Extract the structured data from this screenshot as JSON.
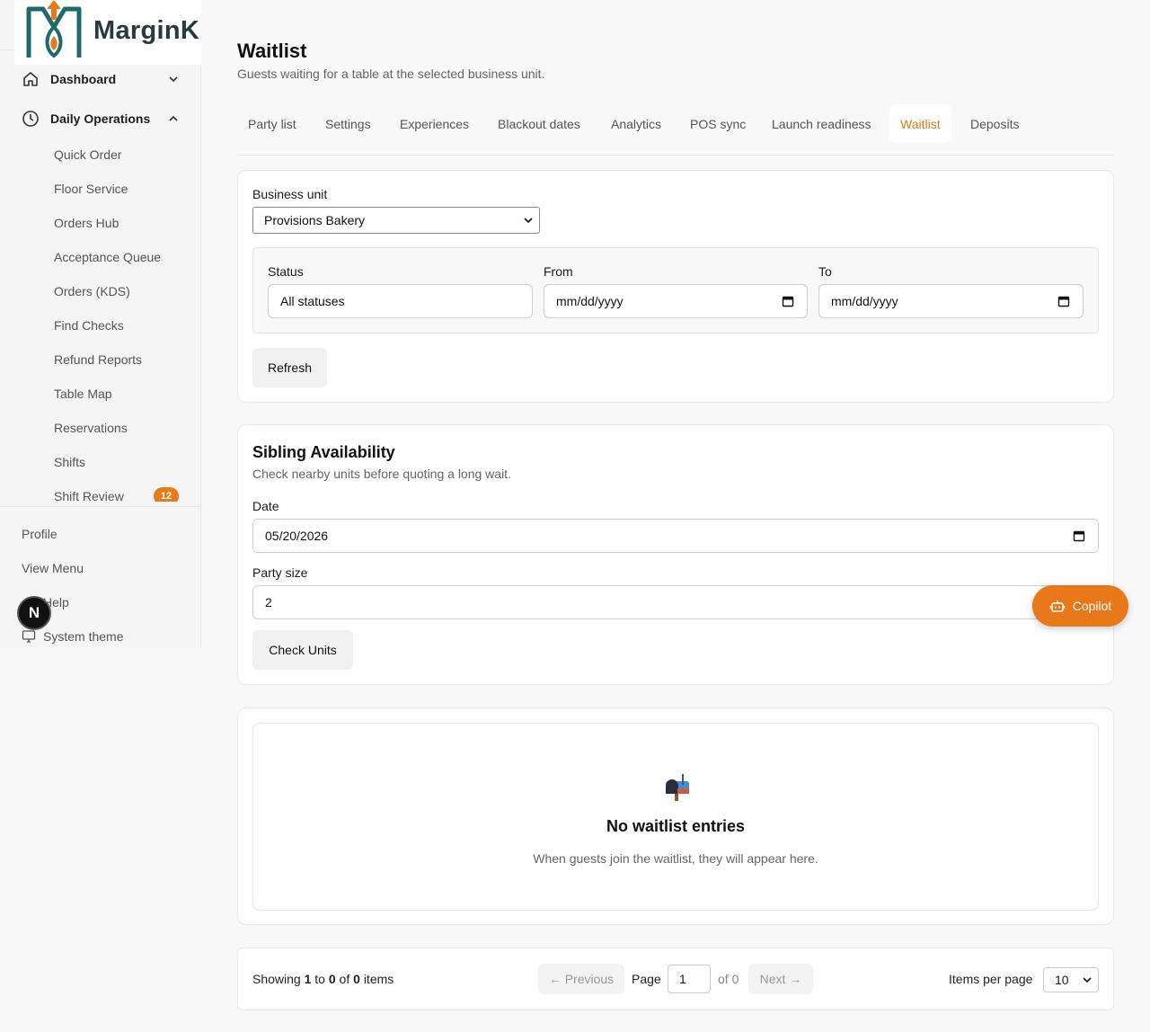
{
  "brand": {
    "name": "MarginK"
  },
  "sidebar": {
    "groups": [
      {
        "label": "Dashboard",
        "icon": "home-icon",
        "expanded": false
      },
      {
        "label": "Daily Operations",
        "icon": "clock-icon",
        "expanded": true
      }
    ],
    "sub_items": [
      "Quick Order",
      "Floor Service",
      "Orders Hub",
      "Acceptance Queue",
      "Orders (KDS)",
      "Find Checks",
      "Refund Reports",
      "Table Map",
      "Reservations",
      "Shifts",
      "Shift Review"
    ],
    "shift_review_badge": "12",
    "footer": {
      "profile": "Profile",
      "view_menu": "View Menu",
      "help": "Help",
      "theme": "System theme"
    },
    "avatar_letter": "N"
  },
  "page": {
    "title": "Waitlist",
    "subtitle": "Guests waiting for a table at the selected business unit."
  },
  "tabs": [
    "Party list",
    "Settings",
    "Experiences",
    "Blackout dates",
    "Analytics",
    "POS sync",
    "Launch readiness",
    "Waitlist",
    "Deposits"
  ],
  "active_tab": "Waitlist",
  "filters": {
    "business_unit_label": "Business unit",
    "business_unit_value": "Provisions Bakery",
    "status_label": "Status",
    "status_value": "All statuses",
    "from_label": "From",
    "from_placeholder": "mm/dd/yyyy",
    "to_label": "To",
    "to_placeholder": "mm/dd/yyyy",
    "refresh_label": "Refresh"
  },
  "sibling": {
    "title": "Sibling Availability",
    "subtitle": "Check nearby units before quoting a long wait.",
    "date_label": "Date",
    "date_value": "05/20/2026",
    "party_size_label": "Party size",
    "party_size_value": "2",
    "check_label": "Check Units"
  },
  "empty": {
    "icon": "mailbox-icon",
    "title": "No waitlist entries",
    "subtitle": "When guests join the waitlist, they will appear here."
  },
  "pagination": {
    "showing_prefix": "Showing",
    "from": "1",
    "to_word": "to",
    "to": "0",
    "of_word": "of",
    "total": "0",
    "items_word": "items",
    "previous": "← Previous",
    "page_label": "Page",
    "page_value": "1",
    "of_pages": "of 0",
    "next": "Next →",
    "items_per_page_label": "Items per page",
    "items_per_page_value": "10"
  },
  "copilot": {
    "label": "Copilot"
  },
  "colors": {
    "accent": "#e8781a",
    "brand_teal": "#1d6b6b"
  }
}
